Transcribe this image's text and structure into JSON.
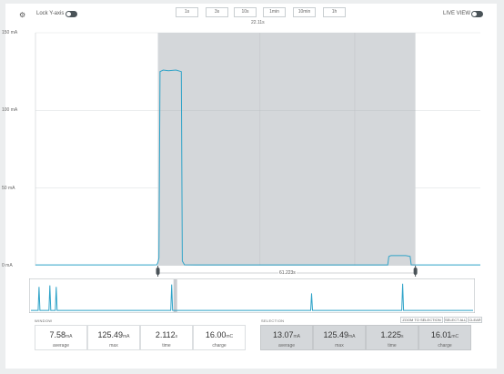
{
  "toolbar": {
    "lock_y_axis_label": "Lock Y-axis",
    "live_view_label": "LIVE VIEW",
    "window_buttons": [
      "1s",
      "3s",
      "10s",
      "1min",
      "10min",
      "1h"
    ]
  },
  "chart_data": {
    "type": "line",
    "y_unit": "mA",
    "y_ticks": [
      "150 mA",
      "100 mA",
      "50 mA",
      "0 mA"
    ],
    "ylim": [
      0,
      150
    ],
    "window_duration_label": "22.11s",
    "selection_duration_label": "61.223s",
    "series": [
      {
        "points": [
          [
            0,
            0.5
          ],
          [
            20,
            0.5
          ],
          [
            40,
            0.5
          ],
          [
            60,
            0.5
          ],
          [
            80,
            0.5
          ],
          [
            100,
            0.5
          ],
          [
            110,
            0.5
          ],
          [
            114,
            0.6
          ],
          [
            115,
            2
          ],
          [
            116,
            5
          ],
          [
            117,
            125
          ],
          [
            120,
            126
          ],
          [
            125,
            125.5
          ],
          [
            132,
            126
          ],
          [
            137,
            125
          ],
          [
            138,
            3
          ],
          [
            140,
            0.6
          ],
          [
            150,
            0.5
          ],
          [
            180,
            0.5
          ],
          [
            220,
            0.5
          ],
          [
            260,
            0.5
          ],
          [
            300,
            0.5
          ],
          [
            331,
            0.5
          ],
          [
            332,
            6
          ],
          [
            334,
            6.5
          ],
          [
            348,
            6.5
          ],
          [
            352,
            6
          ],
          [
            353,
            0.6
          ],
          [
            360,
            0.5
          ],
          [
            400,
            0.5
          ],
          [
            418,
            0.5
          ]
        ]
      }
    ],
    "minimap": {
      "points": [
        [
          0,
          1
        ],
        [
          8,
          1
        ],
        [
          9,
          30
        ],
        [
          10,
          1
        ],
        [
          20,
          1
        ],
        [
          21,
          32
        ],
        [
          22,
          1
        ],
        [
          27,
          1
        ],
        [
          28,
          30
        ],
        [
          29,
          1
        ],
        [
          150,
          1
        ],
        [
          155,
          1
        ],
        [
          156,
          33
        ],
        [
          157,
          1
        ],
        [
          240,
          1
        ],
        [
          300,
          1
        ],
        [
          310,
          1
        ],
        [
          311,
          22
        ],
        [
          312,
          1
        ],
        [
          411,
          1
        ],
        [
          412,
          34
        ],
        [
          413,
          1
        ],
        [
          470,
          1
        ],
        [
          490,
          1
        ]
      ],
      "selection_range": [
        158,
        162
      ]
    }
  },
  "stats": {
    "window_title": "WINDOW",
    "selection_title": "SELECTION",
    "zoom_label": "ZOOM TO SELECTION",
    "select_all_label": "SELECT ALL",
    "clear_label": "CLEAR",
    "window": [
      {
        "value": "7.58",
        "unit": "mA",
        "label": "average"
      },
      {
        "value": "125.49",
        "unit": "mA",
        "label": "max"
      },
      {
        "value": "2.112",
        "unit": "s",
        "label": "time"
      },
      {
        "value": "16.00",
        "unit": "mC",
        "label": "charge"
      }
    ],
    "selection": [
      {
        "value": "13.07",
        "unit": "mA",
        "label": "average"
      },
      {
        "value": "125.49",
        "unit": "mA",
        "label": "max"
      },
      {
        "value": "1.225",
        "unit": "s",
        "label": "time"
      },
      {
        "value": "16.01",
        "unit": "mC",
        "label": "charge"
      }
    ]
  },
  "colors": {
    "trace": "#2fa3c8",
    "selection_fill": "#d4d7da",
    "grid": "#d0d3d6",
    "toggle": "#4a5358"
  }
}
